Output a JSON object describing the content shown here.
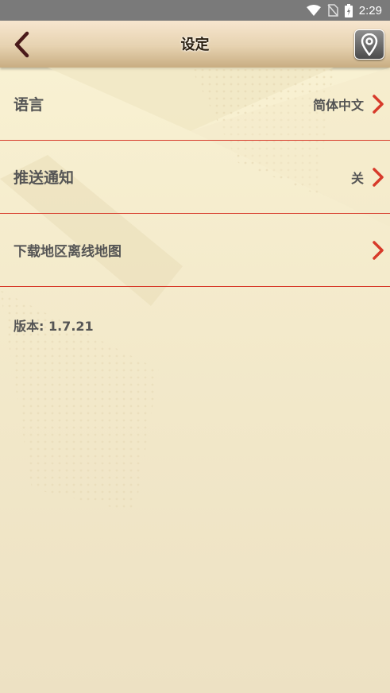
{
  "status_bar": {
    "time": "2:29"
  },
  "header": {
    "title": "设定"
  },
  "settings": [
    {
      "label": "语言",
      "value": "简体中文"
    },
    {
      "label": "推送通知",
      "value": "关"
    },
    {
      "label": "下载地区离线地图",
      "value": ""
    }
  ],
  "version": {
    "text": "版本: 1.7.21"
  },
  "colors": {
    "accent": "#d73a2a",
    "text": "#555555",
    "title": "#2a1f10"
  }
}
